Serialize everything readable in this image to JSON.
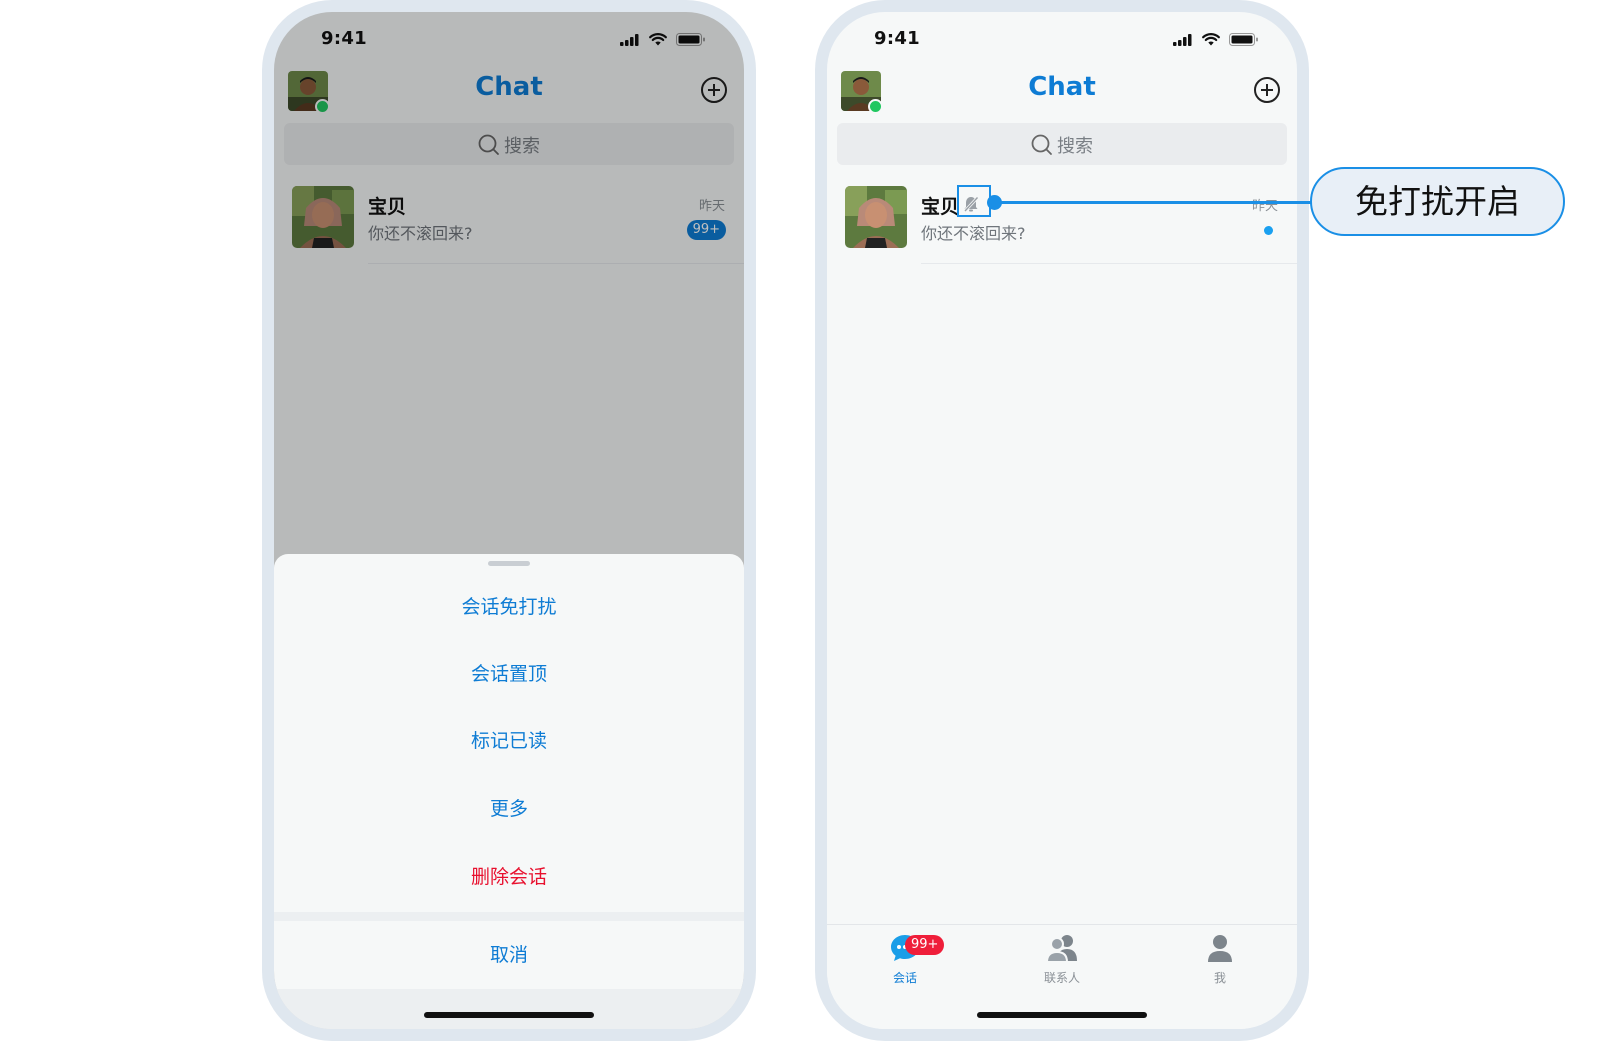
{
  "status_bar": {
    "time": "9:41"
  },
  "header": {
    "title": "Chat"
  },
  "search": {
    "placeholder": "搜索"
  },
  "conversation": {
    "name": "宝贝",
    "preview": "你还不滚回来?",
    "time": "昨天",
    "unread_badge": "99+"
  },
  "action_sheet": {
    "items": [
      "会话免打扰",
      "会话置顶",
      "标记已读",
      "更多",
      "删除会话"
    ],
    "cancel": "取消"
  },
  "tab_bar": {
    "tabs": [
      {
        "label": "会话",
        "icon": "chat-bubble-icon",
        "badge": "99+",
        "active": true
      },
      {
        "label": "联系人",
        "icon": "contacts-icon",
        "active": false
      },
      {
        "label": "我",
        "icon": "person-icon",
        "active": false
      }
    ]
  },
  "callout": {
    "text": "免打扰开启"
  },
  "colors": {
    "accent": "#0e7cd4",
    "danger": "#e8102e",
    "online": "#20c760",
    "badge_red": "#ef1e3a"
  }
}
